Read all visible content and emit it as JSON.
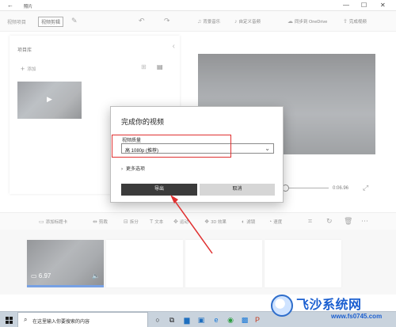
{
  "app": {
    "title": "照片",
    "back_icon": "back-arrow-icon"
  },
  "window_controls": {
    "minimize": "—",
    "maximize": "☐",
    "close": "✕"
  },
  "toolbar": {
    "breadcrumb_root": "视频项目",
    "breadcrumb_current": "视频剪辑",
    "actions": {
      "background_music": "背景音乐",
      "custom_audio": "自定义音频",
      "sync_onedrive": "同步到 OneDrive",
      "finish_video": "完成视频"
    }
  },
  "library": {
    "title": "项目库",
    "add_label": "添加"
  },
  "player": {
    "time": "0:06.96"
  },
  "storyboard_toolbar": {
    "add_title_card": "添加标题卡",
    "trim": "剪裁",
    "split": "拆分",
    "text": "文本",
    "motion": "运动",
    "effects_3d": "3D 效果",
    "filters": "滤镜",
    "speed": "速度"
  },
  "storyboard": {
    "clip_duration": "6.97"
  },
  "dialog": {
    "title": "完成你的视频",
    "quality_label": "视频质量",
    "quality_value": "高 1080p (推荐)",
    "more_options": "更多选项",
    "export_label": "导出",
    "cancel_label": "取消"
  },
  "taskbar": {
    "search_placeholder": "在这里输入你要搜索的内容"
  },
  "watermark": {
    "brand": "飞沙系统网",
    "url": "www.fs0745.com"
  },
  "colors": {
    "annotation_red": "#e03030",
    "selection_blue": "#2f6fd6",
    "export_button": "#3b3b3b"
  }
}
